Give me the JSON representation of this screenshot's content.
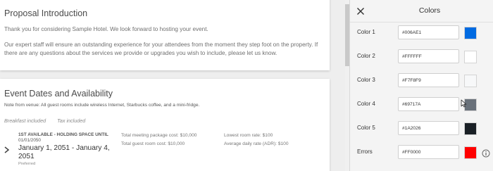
{
  "proposal_intro": {
    "title": "Proposal Introduction",
    "paragraph_1": "Thank you for considering Sample Hotel. We look forward to hosting your event.",
    "paragraph_2": "Our expert staff will ensure an outstanding experience for your attendees from the moment they step foot on the property. If there are any questions about the services we provide or upgrades you wish to include, please let us know."
  },
  "event_dates": {
    "title": "Event Dates and Availability",
    "venue_note": "Note from venue: All guest rooms include wireless Internet, Starbucks coffee, and a mini-fridge.",
    "inclusions": [
      "Breakfast included",
      "Tax included"
    ],
    "availability": {
      "heading": "1ST AVAILABLE - HOLDING SPACE UNTIL",
      "hold_until": "01/01/2050",
      "date_range": "January 1, 2051 - January 4, 2051",
      "status": "Preferred",
      "meeting_package_cost": "Total meeting package cost: $10,000",
      "guest_room_cost": "Total guest room cost: $10,000",
      "lowest_room_rate": "Lowest room rate: $100",
      "average_daily_rate": "Average daily rate (ADR): $100"
    }
  },
  "colors_panel": {
    "title": "Colors",
    "close_icon": "close-icon",
    "rows": [
      {
        "label": "Color 1",
        "value": "#006AE1",
        "swatch": "#006AE1"
      },
      {
        "label": "Color 2",
        "value": "#FFFFFF",
        "swatch": "#FFFFFF"
      },
      {
        "label": "Color 3",
        "value": "#F7F8F9",
        "swatch": "#F7F8F9"
      },
      {
        "label": "Color 4",
        "value": "#69717A",
        "swatch": "#69717A"
      },
      {
        "label": "Color 5",
        "value": "#1A2026",
        "swatch": "#1A2026"
      },
      {
        "label": "Errors",
        "value": "#FF0000",
        "swatch": "#FF0000"
      }
    ],
    "info_icon": "info-icon"
  }
}
